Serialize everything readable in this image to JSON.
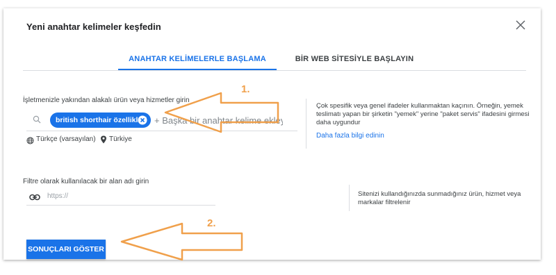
{
  "dialog": {
    "title": "Yeni anahtar kelimeler keşfedin"
  },
  "tabs": [
    {
      "label": "ANAHTAR KELİMELERLE BAŞLAMA",
      "active": true
    },
    {
      "label": "BİR WEB SİTESİYLE BAŞLAYIN",
      "active": false
    }
  ],
  "keywords": {
    "label": "İşletmenizle yakından alakalı ürün veya hizmetler girin",
    "chip": "british shorthair özellikleri",
    "placeholder": "+ Başka bir anahtar kelime ekleyin",
    "language": "Türkçe (varsayılan)",
    "location": "Türkiye",
    "help": "Çok spesifik veya genel ifadeler kullanmaktan kaçının. Örneğin, yemek teslimatı yapan bir şirketin \"yemek\" yerine \"paket servis\" ifadesini girmesi daha uygundur",
    "learn_more": "Daha fazla bilgi edinin"
  },
  "filter": {
    "label": "Filtre olarak kullanılacak bir alan adı girin",
    "placeholder": "https://",
    "help": "Sitenizi kullandığınızda sunmadığınız ürün, hizmet veya markalar filtrelenir"
  },
  "actions": {
    "show_results": "SONUÇLARI GÖSTER"
  },
  "annotations": {
    "step1": "1.",
    "step2": "2.",
    "arrow_color": "#f0a04b"
  },
  "colors": {
    "accent": "#1a73e8"
  }
}
